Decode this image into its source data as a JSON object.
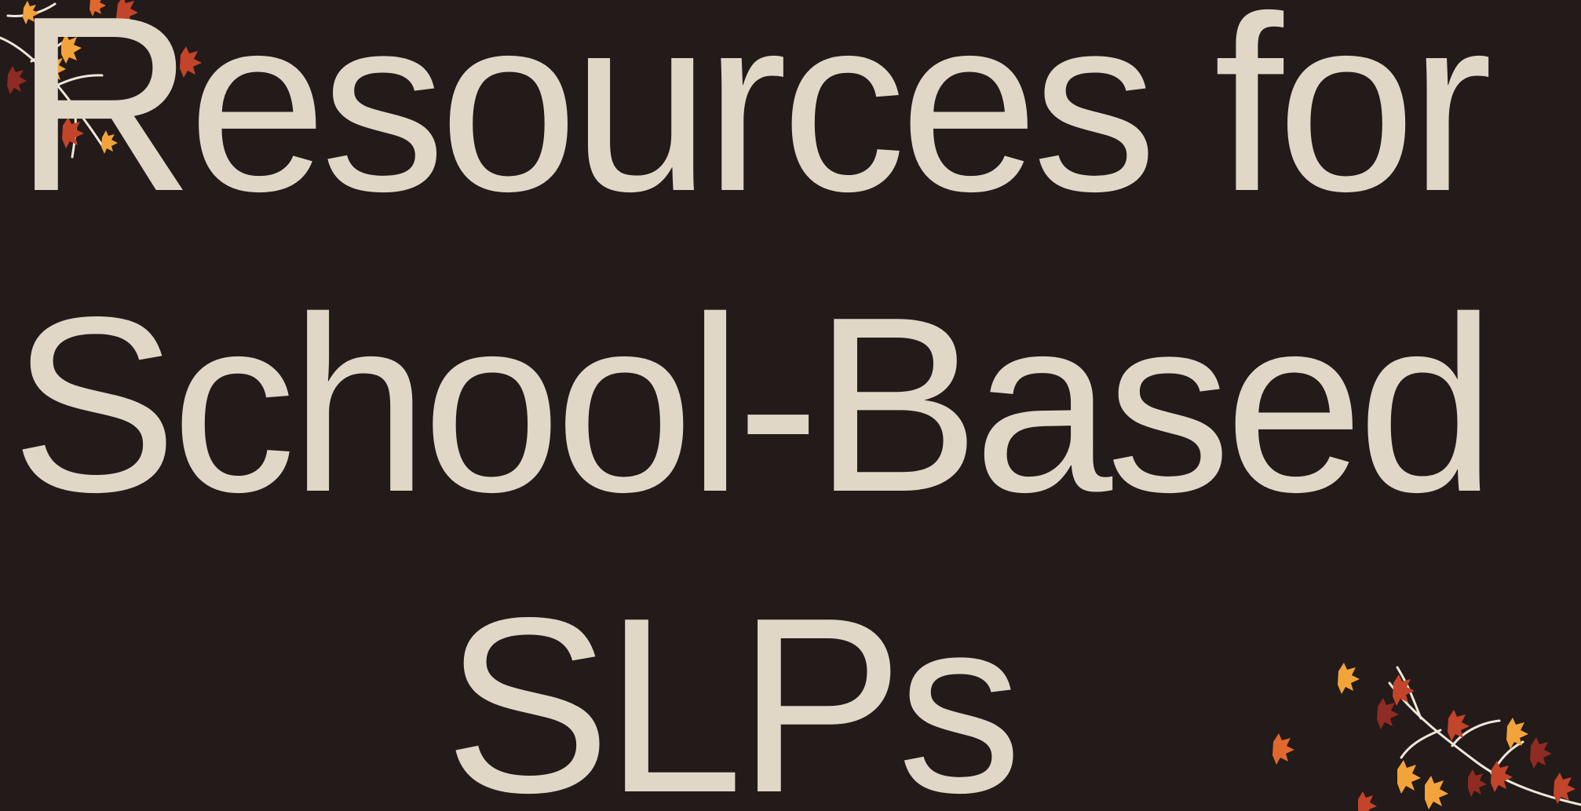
{
  "slide": {
    "background": "#231a1a",
    "text_color": "#e1d7c7",
    "title_lines": [
      "Resources for",
      "School-Based",
      "SLPs"
    ]
  },
  "decorations": {
    "top_left": "autumn-leaf-branch",
    "bottom_right": "autumn-leaf-branch",
    "leaf_colors": [
      "#f2a33a",
      "#c2442a",
      "#8e2b22",
      "#e0682f"
    ]
  }
}
